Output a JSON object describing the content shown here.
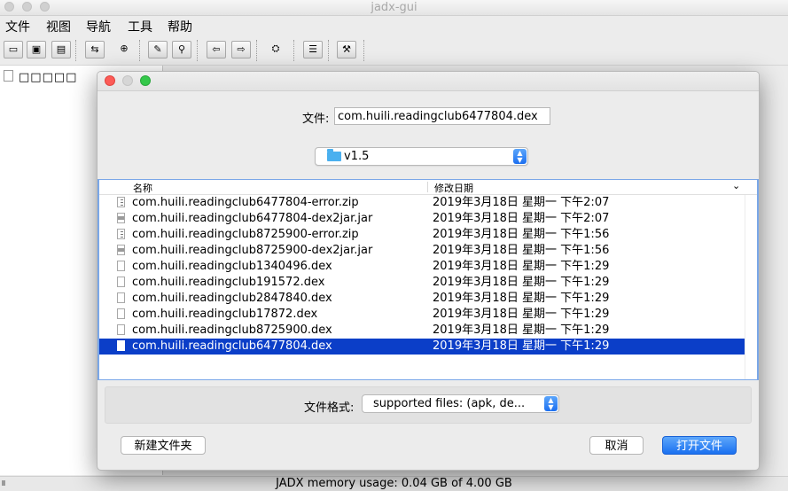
{
  "window": {
    "title": "jadx-gui"
  },
  "menubar": {
    "items": [
      "文件",
      "视图",
      "导航",
      "工具",
      "帮助"
    ]
  },
  "toolbar": {
    "buttons": [
      {
        "icon": "open-file-icon"
      },
      {
        "icon": "save-all-icon"
      },
      {
        "icon": "export-icon"
      },
      {
        "icon": "sync-icon"
      },
      {
        "icon": "flatten-packages-icon"
      },
      {
        "icon": "find-icon"
      },
      {
        "icon": "search-icon"
      },
      {
        "icon": "back-icon"
      },
      {
        "icon": "forward-icon"
      },
      {
        "icon": "deobfuscation-icon"
      },
      {
        "icon": "log-icon"
      },
      {
        "icon": "preferences-icon"
      }
    ]
  },
  "tree": {
    "root_label": "□□□□□"
  },
  "status": {
    "text": "JADX memory usage: 0.04 GB of 4.00 GB"
  },
  "dialog": {
    "filename_label": "文件:",
    "filename_value": "com.huili.readingclub6477804.dex",
    "directory": "v1.5",
    "columns": {
      "name": "名称",
      "date": "修改日期"
    },
    "files": [
      {
        "name": "com.huili.readingclub6477804-error.zip",
        "date": "2019年3月18日 星期一 下午2:07",
        "type": "zip"
      },
      {
        "name": "com.huili.readingclub6477804-dex2jar.jar",
        "date": "2019年3月18日 星期一 下午2:07",
        "type": "jar"
      },
      {
        "name": "com.huili.readingclub8725900-error.zip",
        "date": "2019年3月18日 星期一 下午1:56",
        "type": "zip"
      },
      {
        "name": "com.huili.readingclub8725900-dex2jar.jar",
        "date": "2019年3月18日 星期一 下午1:56",
        "type": "jar"
      },
      {
        "name": "com.huili.readingclub1340496.dex",
        "date": "2019年3月18日 星期一 下午1:29",
        "type": "dex"
      },
      {
        "name": "com.huili.readingclub191572.dex",
        "date": "2019年3月18日 星期一 下午1:29",
        "type": "dex"
      },
      {
        "name": "com.huili.readingclub2847840.dex",
        "date": "2019年3月18日 星期一 下午1:29",
        "type": "dex"
      },
      {
        "name": "com.huili.readingclub17872.dex",
        "date": "2019年3月18日 星期一 下午1:29",
        "type": "dex"
      },
      {
        "name": "com.huili.readingclub8725900.dex",
        "date": "2019年3月18日 星期一 下午1:29",
        "type": "dex"
      },
      {
        "name": "com.huili.readingclub6477804.dex",
        "date": "2019年3月18日 星期一 下午1:29",
        "type": "dex",
        "selected": true
      }
    ],
    "format_label": "文件格式:",
    "format_value": "supported files: (apk, de...",
    "new_folder_label": "新建文件夹",
    "cancel_label": "取消",
    "open_label": "打开文件"
  },
  "colors": {
    "selection": "#0b3ec8",
    "accent": "#1a70f0"
  }
}
